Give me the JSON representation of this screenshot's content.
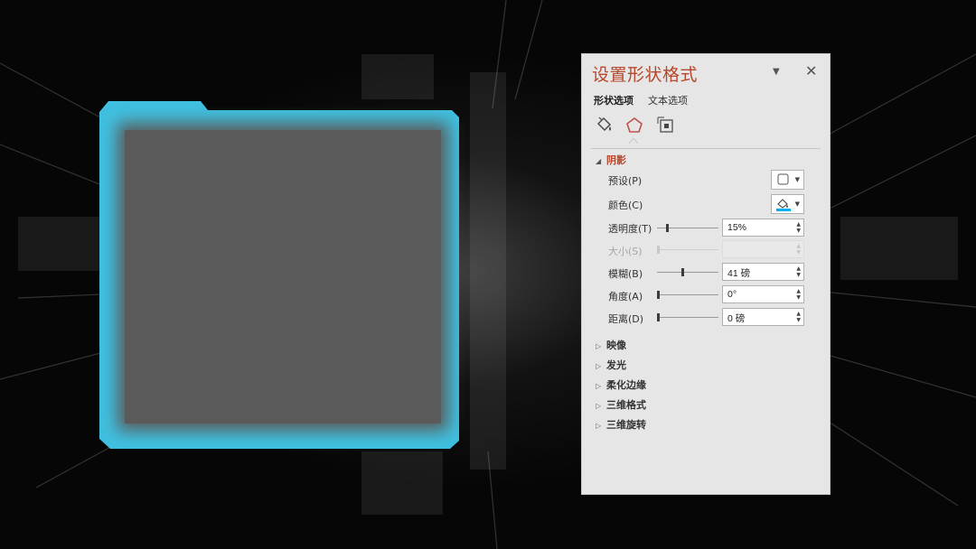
{
  "slide": {
    "shape_fill": "#5a5a5a",
    "glow_color": "#3fc0e0",
    "background_color": "#050505"
  },
  "pane": {
    "title": "设置形状格式",
    "dropdown_icon": "caret-down-icon",
    "close_icon": "close-icon",
    "tabs": [
      {
        "label": "形状选项",
        "active": true
      },
      {
        "label": "文本选项",
        "active": false
      }
    ],
    "category_icons": [
      "fill-line-icon",
      "effects-pentagon-icon",
      "size-properties-icon"
    ],
    "accent_color": "#b7472a",
    "shadow": {
      "header": "阴影",
      "preset": {
        "label": "预设(P)"
      },
      "color": {
        "label": "颜色(C)",
        "swatch": "#00b0f0"
      },
      "transparency": {
        "label": "透明度(T)",
        "value": "15%",
        "fraction": 0.15
      },
      "size": {
        "label": "大小(S)",
        "value": "",
        "disabled": true
      },
      "blur": {
        "label": "模糊(B)",
        "value": "41 磅",
        "fraction": 0.41
      },
      "angle": {
        "label": "角度(A)",
        "value": "0°",
        "fraction": 0.0
      },
      "distance": {
        "label": "距离(D)",
        "value": "0 磅",
        "fraction": 0.0
      }
    },
    "sections": [
      {
        "label": "映像"
      },
      {
        "label": "发光"
      },
      {
        "label": "柔化边缘"
      },
      {
        "label": "三维格式"
      },
      {
        "label": "三维旋转"
      }
    ]
  }
}
